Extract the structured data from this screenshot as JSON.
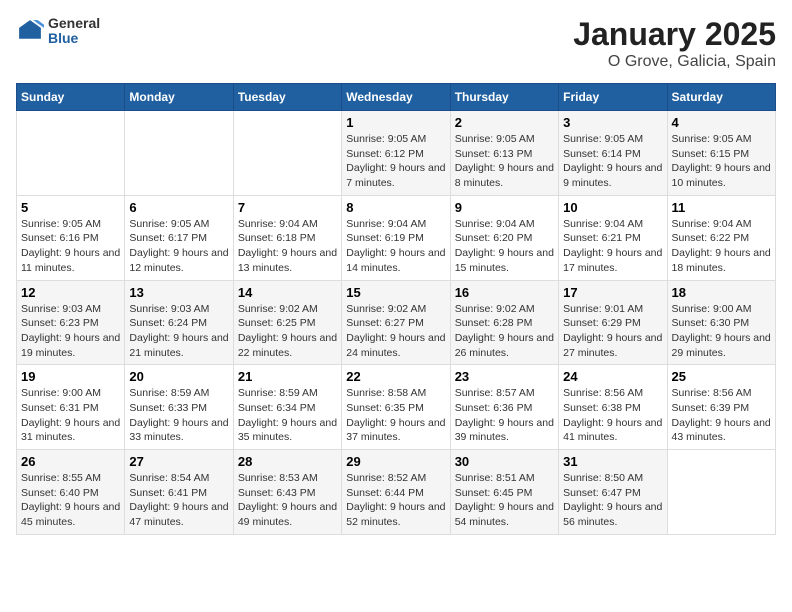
{
  "header": {
    "logo_general": "General",
    "logo_blue": "Blue",
    "title": "January 2025",
    "subtitle": "O Grove, Galicia, Spain"
  },
  "columns": [
    "Sunday",
    "Monday",
    "Tuesday",
    "Wednesday",
    "Thursday",
    "Friday",
    "Saturday"
  ],
  "weeks": [
    [
      {
        "day": "",
        "info": ""
      },
      {
        "day": "",
        "info": ""
      },
      {
        "day": "",
        "info": ""
      },
      {
        "day": "1",
        "info": "Sunrise: 9:05 AM\nSunset: 6:12 PM\nDaylight: 9 hours and 7 minutes."
      },
      {
        "day": "2",
        "info": "Sunrise: 9:05 AM\nSunset: 6:13 PM\nDaylight: 9 hours and 8 minutes."
      },
      {
        "day": "3",
        "info": "Sunrise: 9:05 AM\nSunset: 6:14 PM\nDaylight: 9 hours and 9 minutes."
      },
      {
        "day": "4",
        "info": "Sunrise: 9:05 AM\nSunset: 6:15 PM\nDaylight: 9 hours and 10 minutes."
      }
    ],
    [
      {
        "day": "5",
        "info": "Sunrise: 9:05 AM\nSunset: 6:16 PM\nDaylight: 9 hours and 11 minutes."
      },
      {
        "day": "6",
        "info": "Sunrise: 9:05 AM\nSunset: 6:17 PM\nDaylight: 9 hours and 12 minutes."
      },
      {
        "day": "7",
        "info": "Sunrise: 9:04 AM\nSunset: 6:18 PM\nDaylight: 9 hours and 13 minutes."
      },
      {
        "day": "8",
        "info": "Sunrise: 9:04 AM\nSunset: 6:19 PM\nDaylight: 9 hours and 14 minutes."
      },
      {
        "day": "9",
        "info": "Sunrise: 9:04 AM\nSunset: 6:20 PM\nDaylight: 9 hours and 15 minutes."
      },
      {
        "day": "10",
        "info": "Sunrise: 9:04 AM\nSunset: 6:21 PM\nDaylight: 9 hours and 17 minutes."
      },
      {
        "day": "11",
        "info": "Sunrise: 9:04 AM\nSunset: 6:22 PM\nDaylight: 9 hours and 18 minutes."
      }
    ],
    [
      {
        "day": "12",
        "info": "Sunrise: 9:03 AM\nSunset: 6:23 PM\nDaylight: 9 hours and 19 minutes."
      },
      {
        "day": "13",
        "info": "Sunrise: 9:03 AM\nSunset: 6:24 PM\nDaylight: 9 hours and 21 minutes."
      },
      {
        "day": "14",
        "info": "Sunrise: 9:02 AM\nSunset: 6:25 PM\nDaylight: 9 hours and 22 minutes."
      },
      {
        "day": "15",
        "info": "Sunrise: 9:02 AM\nSunset: 6:27 PM\nDaylight: 9 hours and 24 minutes."
      },
      {
        "day": "16",
        "info": "Sunrise: 9:02 AM\nSunset: 6:28 PM\nDaylight: 9 hours and 26 minutes."
      },
      {
        "day": "17",
        "info": "Sunrise: 9:01 AM\nSunset: 6:29 PM\nDaylight: 9 hours and 27 minutes."
      },
      {
        "day": "18",
        "info": "Sunrise: 9:00 AM\nSunset: 6:30 PM\nDaylight: 9 hours and 29 minutes."
      }
    ],
    [
      {
        "day": "19",
        "info": "Sunrise: 9:00 AM\nSunset: 6:31 PM\nDaylight: 9 hours and 31 minutes."
      },
      {
        "day": "20",
        "info": "Sunrise: 8:59 AM\nSunset: 6:33 PM\nDaylight: 9 hours and 33 minutes."
      },
      {
        "day": "21",
        "info": "Sunrise: 8:59 AM\nSunset: 6:34 PM\nDaylight: 9 hours and 35 minutes."
      },
      {
        "day": "22",
        "info": "Sunrise: 8:58 AM\nSunset: 6:35 PM\nDaylight: 9 hours and 37 minutes."
      },
      {
        "day": "23",
        "info": "Sunrise: 8:57 AM\nSunset: 6:36 PM\nDaylight: 9 hours and 39 minutes."
      },
      {
        "day": "24",
        "info": "Sunrise: 8:56 AM\nSunset: 6:38 PM\nDaylight: 9 hours and 41 minutes."
      },
      {
        "day": "25",
        "info": "Sunrise: 8:56 AM\nSunset: 6:39 PM\nDaylight: 9 hours and 43 minutes."
      }
    ],
    [
      {
        "day": "26",
        "info": "Sunrise: 8:55 AM\nSunset: 6:40 PM\nDaylight: 9 hours and 45 minutes."
      },
      {
        "day": "27",
        "info": "Sunrise: 8:54 AM\nSunset: 6:41 PM\nDaylight: 9 hours and 47 minutes."
      },
      {
        "day": "28",
        "info": "Sunrise: 8:53 AM\nSunset: 6:43 PM\nDaylight: 9 hours and 49 minutes."
      },
      {
        "day": "29",
        "info": "Sunrise: 8:52 AM\nSunset: 6:44 PM\nDaylight: 9 hours and 52 minutes."
      },
      {
        "day": "30",
        "info": "Sunrise: 8:51 AM\nSunset: 6:45 PM\nDaylight: 9 hours and 54 minutes."
      },
      {
        "day": "31",
        "info": "Sunrise: 8:50 AM\nSunset: 6:47 PM\nDaylight: 9 hours and 56 minutes."
      },
      {
        "day": "",
        "info": ""
      }
    ]
  ]
}
